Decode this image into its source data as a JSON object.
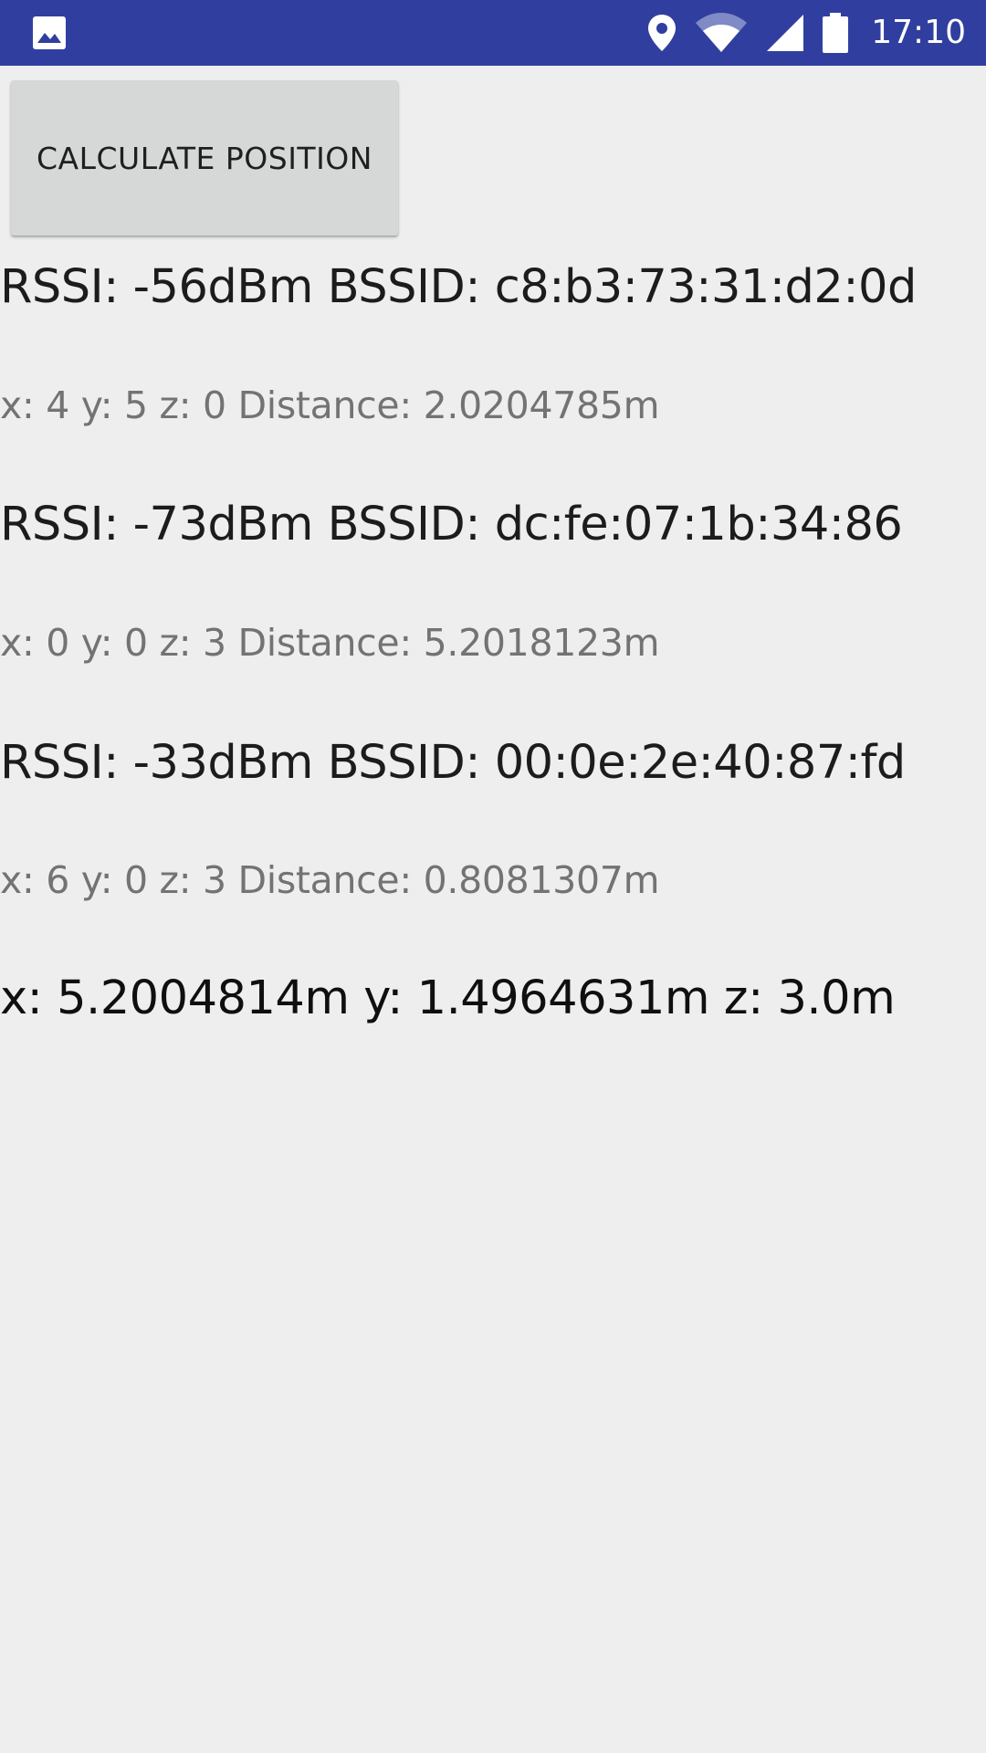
{
  "status_bar": {
    "left_icon": "image-icon",
    "right_icons": [
      "location-icon",
      "wifi-icon",
      "signal-icon",
      "battery-icon"
    ],
    "time": "17:10",
    "background": "#303f9f"
  },
  "button": {
    "label": "CALCULATE POSITION"
  },
  "access_points": [
    {
      "rssi_text": "RSSI: -56dBm BSSID: c8:b3:73:31:d2:0d",
      "position_text": "x: 4 y: 5 z: 0 Distance: 2.0204785m"
    },
    {
      "rssi_text": "RSSI: -73dBm BSSID: dc:fe:07:1b:34:86",
      "position_text": "x: 0 y: 0 z: 3 Distance: 5.2018123m"
    },
    {
      "rssi_text": "RSSI: -33dBm BSSID: 00:0e:2e:40:87:fd",
      "position_text": "x: 6 y: 0 z: 3 Distance: 0.8081307m"
    }
  ],
  "result": {
    "text": "x: 5.2004814m y: 1.4964631m z: 3.0m"
  }
}
